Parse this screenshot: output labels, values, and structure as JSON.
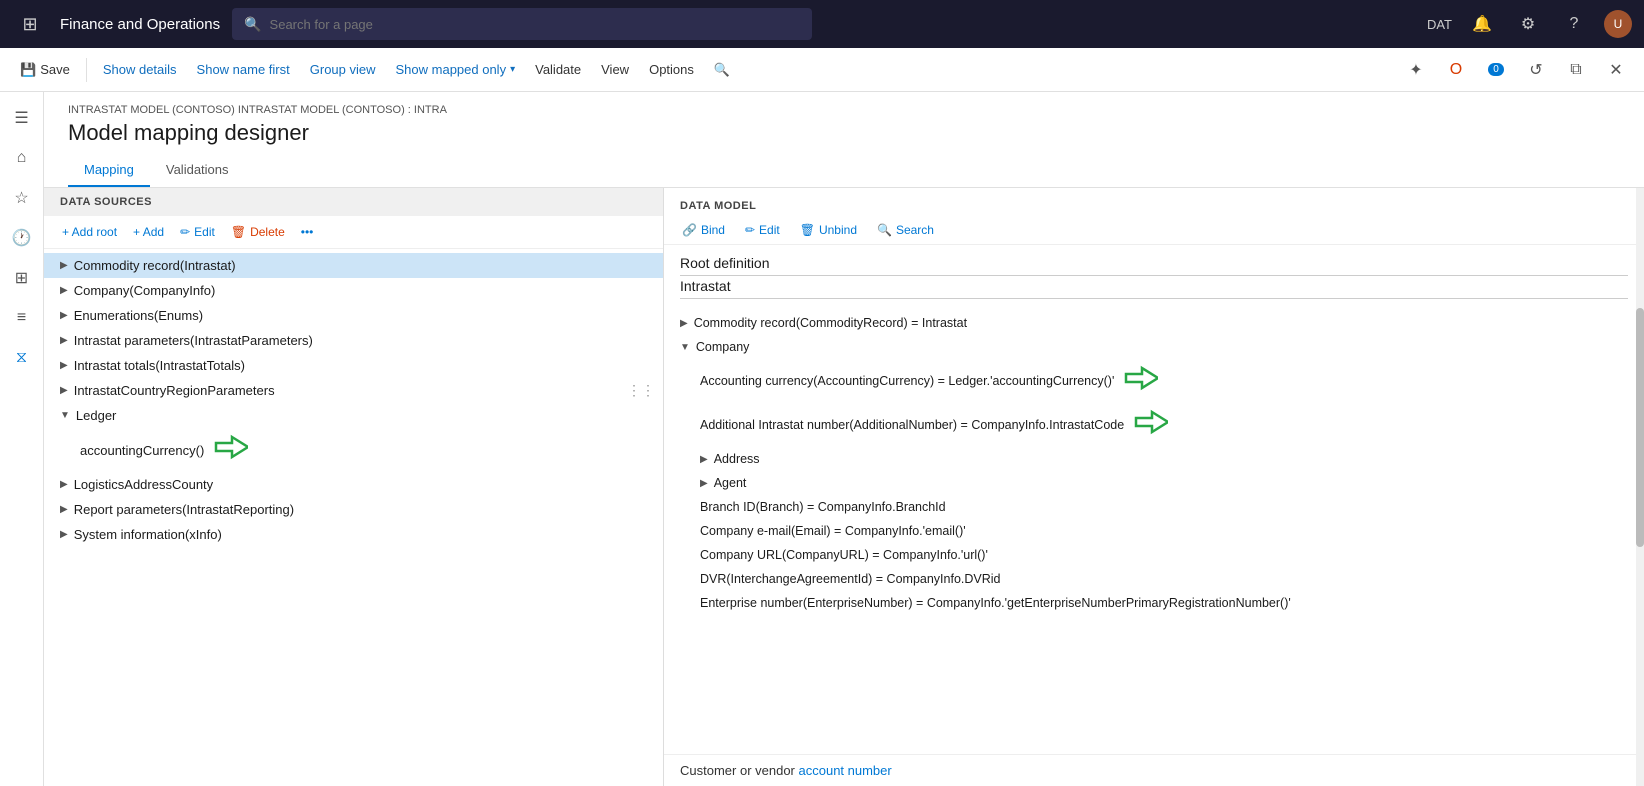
{
  "topNav": {
    "appTitle": "Finance and Operations",
    "searchPlaceholder": "Search for a page",
    "envLabel": "DAT"
  },
  "toolbar": {
    "save": "Save",
    "showDetails": "Show details",
    "showNameFirst": "Show name first",
    "groupView": "Group view",
    "showMappedOnly": "Show mapped only",
    "validate": "Validate",
    "view": "View",
    "options": "Options",
    "notificationsCount": "0"
  },
  "page": {
    "breadcrumb": "INTRASTAT MODEL (CONTOSO) INTRASTAT MODEL (CONTOSO) : INTRA",
    "title": "Model mapping designer",
    "tabs": [
      "Mapping",
      "Validations"
    ]
  },
  "dataSources": {
    "header": "DATA SOURCES",
    "addRoot": "+ Add root",
    "add": "+ Add",
    "edit": "Edit",
    "delete": "Delete",
    "items": [
      {
        "label": "Commodity record(Intrastat)",
        "level": 0,
        "expanded": false,
        "selected": true
      },
      {
        "label": "Company(CompanyInfo)",
        "level": 0,
        "expanded": false
      },
      {
        "label": "Enumerations(Enums)",
        "level": 0,
        "expanded": false
      },
      {
        "label": "Intrastat parameters(IntrastatParameters)",
        "level": 0,
        "expanded": false
      },
      {
        "label": "Intrastat totals(IntrastatTotals)",
        "level": 0,
        "expanded": false
      },
      {
        "label": "IntrastatCountryRegionParameters",
        "level": 0,
        "expanded": false
      },
      {
        "label": "Ledger",
        "level": 0,
        "expanded": true
      },
      {
        "label": "accountingCurrency()",
        "level": 1,
        "expanded": false,
        "hasArrow": true
      },
      {
        "label": "LogisticsAddressCounty",
        "level": 0,
        "expanded": false
      },
      {
        "label": "Report parameters(IntrastatReporting)",
        "level": 0,
        "expanded": false
      },
      {
        "label": "System information(xInfo)",
        "level": 0,
        "expanded": false
      }
    ]
  },
  "dataModel": {
    "header": "DATA MODEL",
    "bind": "Bind",
    "edit": "Edit",
    "unbind": "Unbind",
    "search": "Search",
    "rootDefinitionLabel": "Root definition",
    "rootDefinitionValue": "Intrastat",
    "items": [
      {
        "label": "Commodity record(CommodityRecord) = Intrastat",
        "level": 0,
        "expanded": false
      },
      {
        "label": "Company",
        "level": 0,
        "expanded": true
      },
      {
        "label": "Accounting currency(AccountingCurrency) = Ledger.'accountingCurrency()'",
        "level": 1,
        "hasArrow": true
      },
      {
        "label": "Additional Intrastat number(AdditionalNumber) = CompanyInfo.IntrastatCode",
        "level": 1,
        "hasArrow": true
      },
      {
        "label": "Address",
        "level": 1,
        "expanded": false
      },
      {
        "label": "Agent",
        "level": 1,
        "expanded": false
      },
      {
        "label": "Branch ID(Branch) = CompanyInfo.BranchId",
        "level": 1
      },
      {
        "label": "Company e-mail(Email) = CompanyInfo.'email()'",
        "level": 1
      },
      {
        "label": "Company URL(CompanyURL) = CompanyInfo.'url()'",
        "level": 1
      },
      {
        "label": "DVR(InterchangeAgreementId) = CompanyInfo.DVRid",
        "level": 1
      },
      {
        "label": "Enterprise number(EnterpriseNumber) = CompanyInfo.'getEnterpriseNumberPrimaryRegistrationNumber()'",
        "level": 1
      }
    ],
    "bottomText": "Customer or vendor account number"
  }
}
